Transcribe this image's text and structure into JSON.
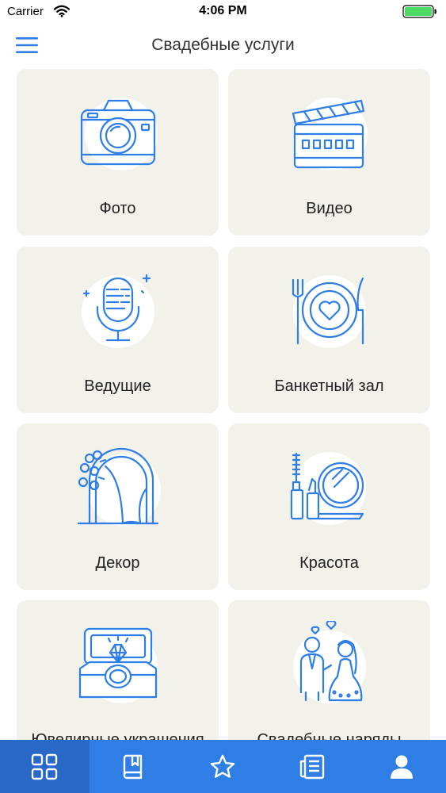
{
  "status": {
    "carrier": "Carrier",
    "time": "4:06 PM"
  },
  "nav": {
    "title": "Свадебные услуги"
  },
  "colors": {
    "accent": "#2f7ee6",
    "tab_active": "#2868c6",
    "card_bg": "#f2f1ea",
    "icon_stroke": "#2f7ee6"
  },
  "categories": [
    {
      "label": "Фото",
      "icon": "camera-icon"
    },
    {
      "label": "Видео",
      "icon": "clapperboard-icon"
    },
    {
      "label": "Ведущие",
      "icon": "microphone-icon"
    },
    {
      "label": "Банкетный зал",
      "icon": "plate-cutlery-icon"
    },
    {
      "label": "Декор",
      "icon": "floral-arch-icon"
    },
    {
      "label": "Красота",
      "icon": "makeup-icon"
    },
    {
      "label": "Ювелирные украшения",
      "icon": "ring-box-icon"
    },
    {
      "label": "Свадебные наряды",
      "icon": "couple-icon"
    }
  ],
  "tabs": [
    {
      "icon": "grid-icon",
      "active": true
    },
    {
      "icon": "bookmark-book-icon",
      "active": false
    },
    {
      "icon": "star-icon",
      "active": false
    },
    {
      "icon": "news-icon",
      "active": false
    },
    {
      "icon": "user-icon",
      "active": false
    }
  ]
}
